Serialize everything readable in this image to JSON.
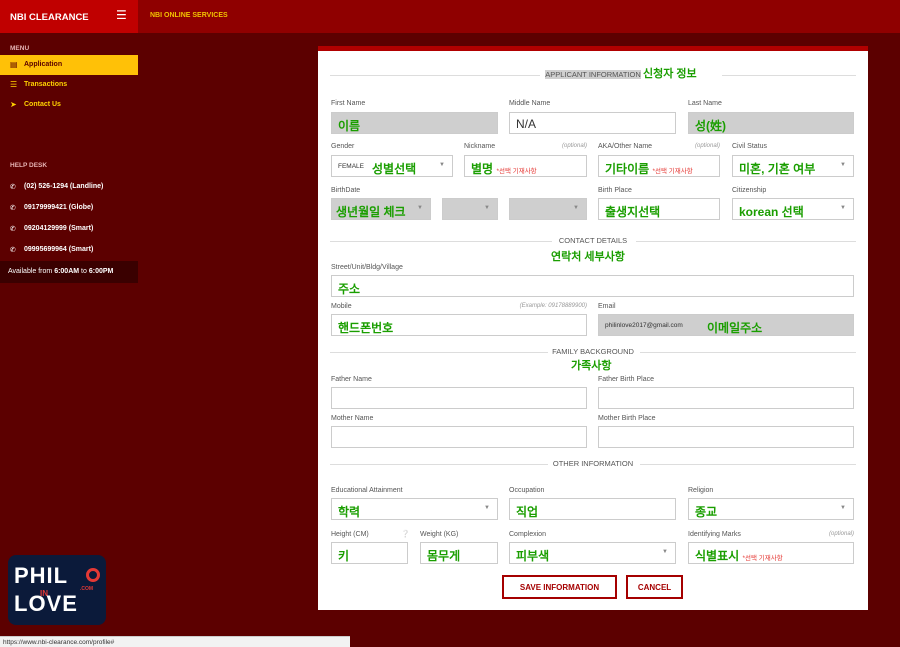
{
  "app": {
    "brand": "NBI CLEARANCE",
    "menu_icon": "hamburger-icon",
    "top_title": "NBI ONLINE SERVICES"
  },
  "sidebar": {
    "menu_heading": "MENU",
    "items": [
      {
        "label": "Application",
        "icon": "document-icon",
        "active": true
      },
      {
        "label": "Transactions",
        "icon": "list-icon",
        "active": false
      },
      {
        "label": "Contact Us",
        "icon": "send-icon",
        "active": false
      }
    ],
    "helpdesk_heading": "HELP DESK",
    "helpdesk": [
      {
        "label": "(02) 526-1294 (Landline)",
        "icon": "phone-icon"
      },
      {
        "label": "09179999421 (Globe)",
        "icon": "phone-icon"
      },
      {
        "label": "09204129999 (Smart)",
        "icon": "phone-icon"
      },
      {
        "label": "09995699964 (Smart)",
        "icon": "phone-icon"
      }
    ],
    "availability": {
      "prefix": "Available from",
      "start": "6:00AM",
      "mid": "to",
      "end": "6:00PM"
    }
  },
  "logo": {
    "line1": "PHIL",
    "line2": "LOVE",
    "in": "IN",
    "com": ".COM"
  },
  "status_url": "https://www.nbi-clearance.com/profile#",
  "form": {
    "applicant": {
      "heading": "APPLICANT INFORMATION",
      "heading_kr": "신청자 정보",
      "first_name": {
        "label": "First Name",
        "value": "이름"
      },
      "middle_name": {
        "label": "Middle Name",
        "value": "N/A"
      },
      "last_name": {
        "label": "Last Name",
        "value": "성(姓)"
      },
      "gender": {
        "label": "Gender",
        "selected": "FEMALE",
        "annotation": "성별선택"
      },
      "nickname": {
        "label": "Nickname",
        "optional": "(optional)",
        "value": "별명",
        "note": "*선택 기재사항"
      },
      "aka": {
        "label": "AKA/Other Name",
        "optional": "(optional)",
        "value": "기타이름",
        "note": "*선택 기재사항"
      },
      "civil_status": {
        "label": "Civil Status",
        "value": "미혼, 기혼 여부"
      },
      "birthdate": {
        "label": "BirthDate",
        "value": "생년월일 체크"
      },
      "birth_place": {
        "label": "Birth Place",
        "value": "출생지선택"
      },
      "citizenship": {
        "label": "Citizenship",
        "value": "korean 선택"
      }
    },
    "contact": {
      "heading": "CONTACT DETAILS",
      "heading_kr": "연락처 세부사항",
      "street": {
        "label": "Street/Unit/Bldg/Village",
        "value": "주소"
      },
      "mobile": {
        "label": "Mobile",
        "example": "(Example: 09178889900)",
        "value": "핸드폰번호"
      },
      "email": {
        "label": "Email",
        "value": "philinlove2017@gmail.com",
        "annotation": "이메일주소"
      }
    },
    "family": {
      "heading": "FAMILY BACKGROUND",
      "heading_kr": "가족사항",
      "father_name": {
        "label": "Father Name"
      },
      "father_birth_place": {
        "label": "Father Birth Place"
      },
      "mother_name": {
        "label": "Mother Name"
      },
      "mother_birth_place": {
        "label": "Mother Birth Place"
      }
    },
    "other": {
      "heading": "OTHER INFORMATION",
      "education": {
        "label": "Educational Attainment",
        "value": "학력"
      },
      "occupation": {
        "label": "Occupation",
        "value": "직업"
      },
      "religion": {
        "label": "Religion",
        "value": "종교"
      },
      "height": {
        "label": "Height (CM)",
        "value": "키"
      },
      "weight": {
        "label": "Weight (KG)",
        "value": "몸무게"
      },
      "complexion": {
        "label": "Complexion",
        "value": "피부색"
      },
      "identifying_marks": {
        "label": "Identifying Marks",
        "optional": "(optional)",
        "value": "식별표시",
        "note": "*선택 기재사항"
      }
    },
    "buttons": {
      "save": "SAVE INFORMATION",
      "cancel": "CANCEL"
    }
  },
  "colors": {
    "topbar": "#8f0000",
    "brand": "#c00000",
    "accent": "#ffc107",
    "panel_border": "#b10000",
    "annotation": "#1a9e00"
  }
}
